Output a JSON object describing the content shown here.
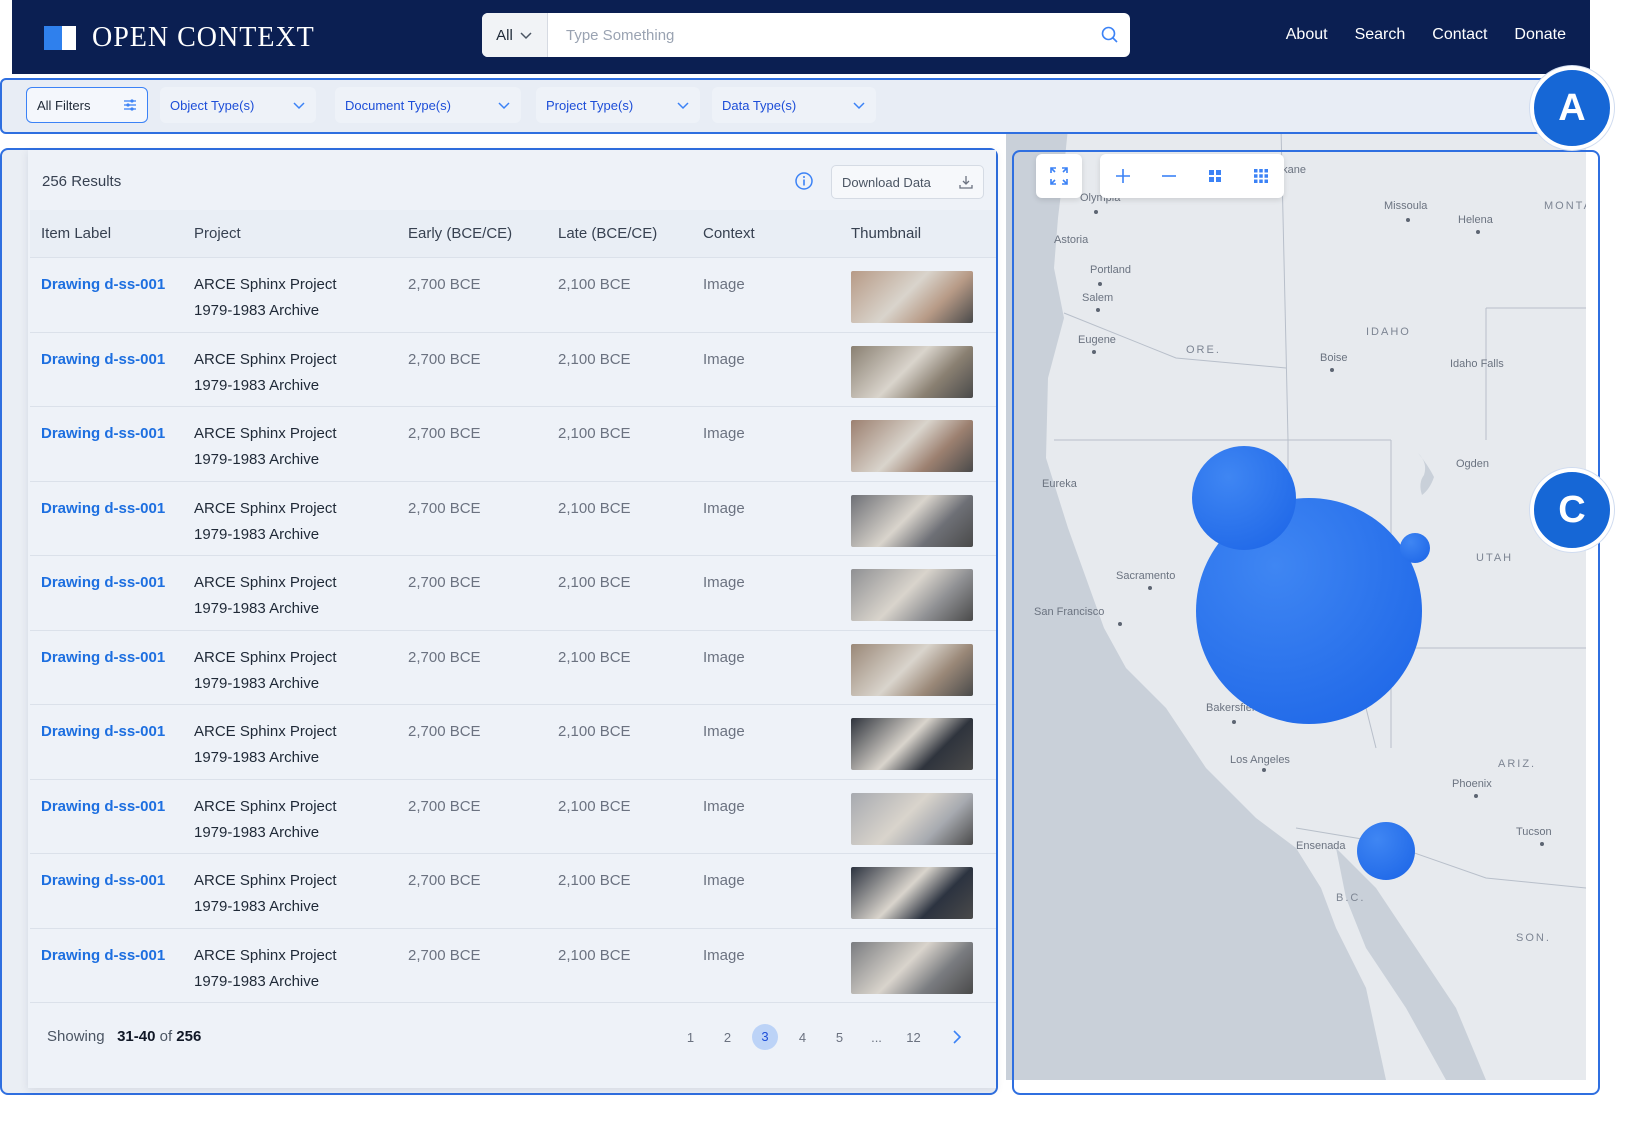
{
  "header": {
    "logo_text": "OPEN CONTEXT",
    "search_scope": "All",
    "search_placeholder": "Type Something",
    "nav": [
      "About",
      "Search",
      "Contact",
      "Donate"
    ]
  },
  "filters": {
    "all_filters": "All Filters",
    "dropdowns": [
      "Object Type(s)",
      "Document Type(s)",
      "Project Type(s)",
      "Data Type(s)"
    ]
  },
  "results": {
    "count_label": "256 Results",
    "download_label": "Download Data",
    "columns": [
      "Item Label",
      "Project",
      "Early (BCE/CE)",
      "Late (BCE/CE)",
      "Context",
      "Thumbnail"
    ],
    "rows": [
      {
        "label": "Drawing d-ss-001",
        "project_line1": "ARCE Sphinx Project",
        "project_line2": "1979-1983 Archive",
        "early": "2,700 BCE",
        "late": "2,100 BCE",
        "context": "Image",
        "thumb_color": "#b79a86"
      },
      {
        "label": "Drawing d-ss-001",
        "project_line1": "ARCE Sphinx Project",
        "project_line2": "1979-1983 Archive",
        "early": "2,700 BCE",
        "late": "2,100 BCE",
        "context": "Image",
        "thumb_color": "#8a8072"
      },
      {
        "label": "Drawing d-ss-001",
        "project_line1": "ARCE Sphinx Project",
        "project_line2": "1979-1983 Archive",
        "early": "2,700 BCE",
        "late": "2,100 BCE",
        "context": "Image",
        "thumb_color": "#9c8070"
      },
      {
        "label": "Drawing d-ss-001",
        "project_line1": "ARCE Sphinx Project",
        "project_line2": "1979-1983 Archive",
        "early": "2,700 BCE",
        "late": "2,100 BCE",
        "context": "Image",
        "thumb_color": "#6e7076"
      },
      {
        "label": "Drawing d-ss-001",
        "project_line1": "ARCE Sphinx Project",
        "project_line2": "1979-1983 Archive",
        "early": "2,700 BCE",
        "late": "2,100 BCE",
        "context": "Image",
        "thumb_color": "#8f9093"
      },
      {
        "label": "Drawing d-ss-001",
        "project_line1": "ARCE Sphinx Project",
        "project_line2": "1979-1983 Archive",
        "early": "2,700 BCE",
        "late": "2,100 BCE",
        "context": "Image",
        "thumb_color": "#9a8878"
      },
      {
        "label": "Drawing d-ss-001",
        "project_line1": "ARCE Sphinx Project",
        "project_line2": "1979-1983 Archive",
        "early": "2,700 BCE",
        "late": "2,100 BCE",
        "context": "Image",
        "thumb_color": "#2f343d"
      },
      {
        "label": "Drawing d-ss-001",
        "project_line1": "ARCE Sphinx Project",
        "project_line2": "1979-1983 Archive",
        "early": "2,700 BCE",
        "late": "2,100 BCE",
        "context": "Image",
        "thumb_color": "#a7aab0"
      },
      {
        "label": "Drawing d-ss-001",
        "project_line1": "ARCE Sphinx Project",
        "project_line2": "1979-1983 Archive",
        "early": "2,700 BCE",
        "late": "2,100 BCE",
        "context": "Image",
        "thumb_color": "#2c3340"
      },
      {
        "label": "Drawing d-ss-001",
        "project_line1": "ARCE Sphinx Project",
        "project_line2": "1979-1983 Archive",
        "early": "2,700 BCE",
        "late": "2,100 BCE",
        "context": "Image",
        "thumb_color": "#7a7c80"
      }
    ]
  },
  "pagination": {
    "showing_label": "Showing",
    "range": "31-40",
    "of_label": "of",
    "total": "256",
    "pages": [
      "1",
      "2",
      "3",
      "4",
      "5",
      "...",
      "12"
    ],
    "current": "3"
  },
  "map": {
    "cities": [
      "Olympia",
      "Astoria",
      "Portland",
      "Salem",
      "Eugene",
      "Missoula",
      "Helena",
      "Boise",
      "Idaho Falls",
      "Eureka",
      "Ogden",
      "Sacramento",
      "San Francisco",
      "Bakersfield",
      "Los Angeles",
      "Phoenix",
      "Tucson",
      "Ensenada",
      "okane"
    ],
    "states": [
      "IDAHO",
      "ORE.",
      "UTAH",
      "ARIZ.",
      "MONTA",
      "B.C.",
      "SON."
    ],
    "cluster_color": "#1a63e6"
  },
  "annotations": {
    "filter_badge": "A",
    "map_badge": "C"
  },
  "colors": {
    "header_bg": "#0b1f52",
    "accent": "#2f6fe0",
    "link": "#1d6fe0"
  }
}
